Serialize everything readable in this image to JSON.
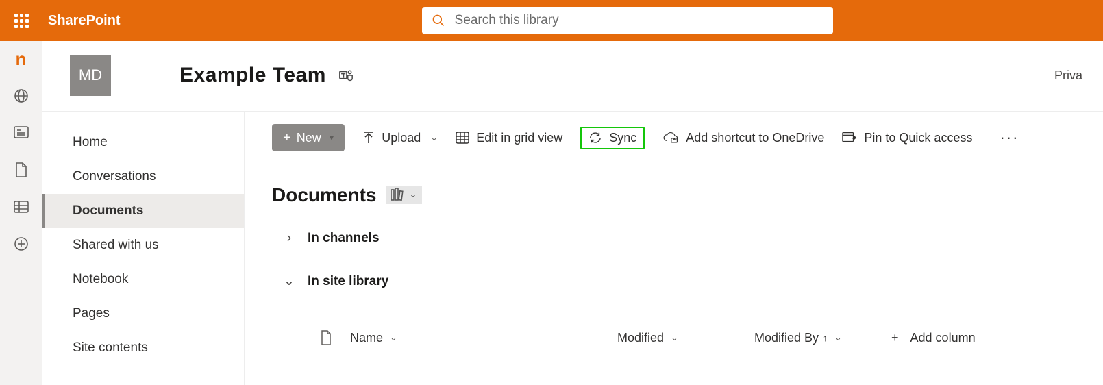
{
  "brand": "SharePoint",
  "search": {
    "placeholder": "Search this library"
  },
  "site": {
    "tile": "MD",
    "name": "Example Team",
    "privacy": "Priva"
  },
  "nav": {
    "items": [
      "Home",
      "Conversations",
      "Documents",
      "Shared with us",
      "Notebook",
      "Pages",
      "Site contents"
    ],
    "active_index": 2
  },
  "commands": {
    "new": "New",
    "upload": "Upload",
    "grid": "Edit in grid view",
    "sync": "Sync",
    "shortcut": "Add shortcut to OneDrive",
    "pin": "Pin to Quick access"
  },
  "library": {
    "title": "Documents",
    "sections": {
      "channels": "In channels",
      "site": "In site library"
    }
  },
  "columns": {
    "name": "Name",
    "modified": "Modified",
    "modified_by": "Modified By",
    "add": "Add column"
  }
}
